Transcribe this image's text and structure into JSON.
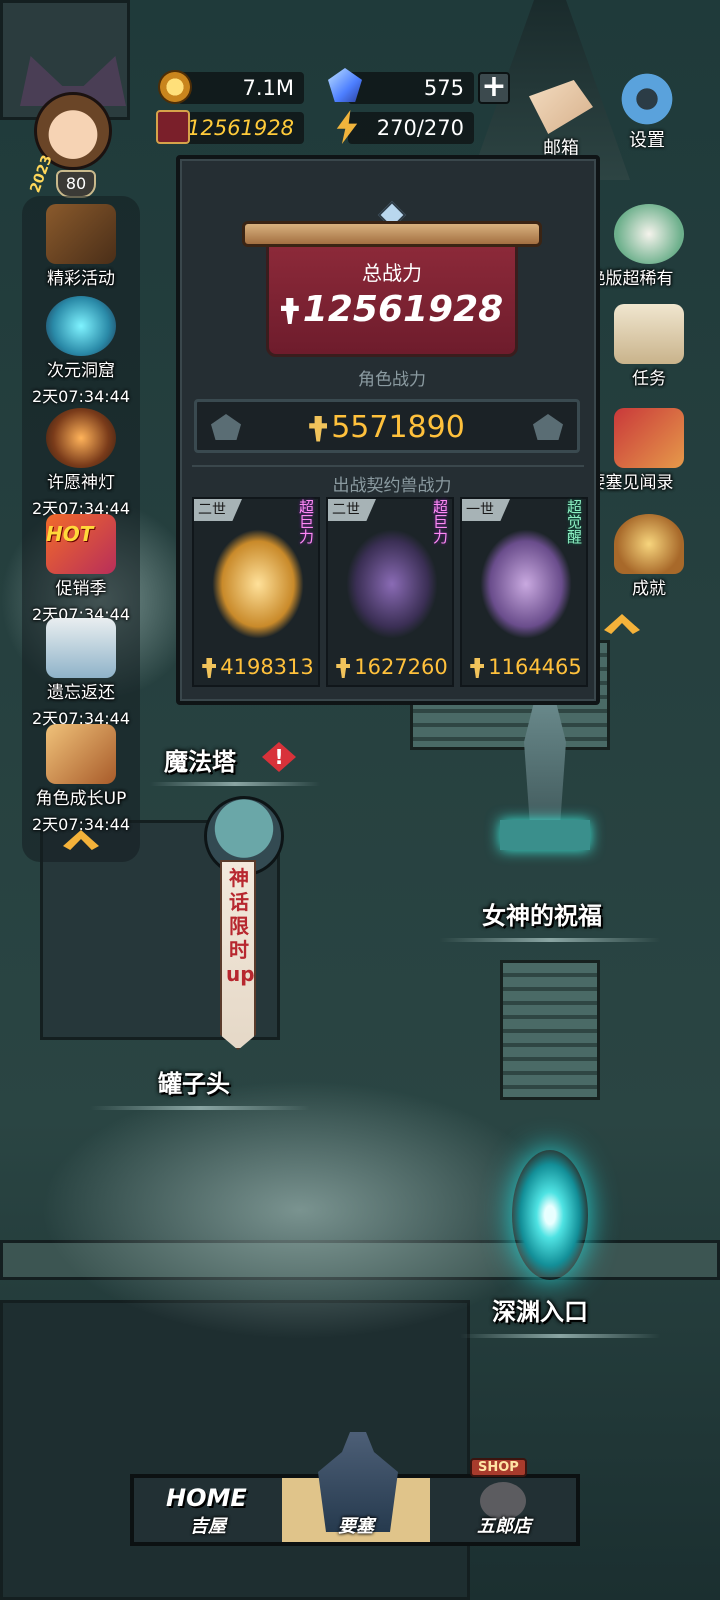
{
  "player": {
    "level": "80",
    "avatar_year": "2023"
  },
  "resources": {
    "coins": "7.1M",
    "gems": "575",
    "power": "12561928",
    "stamina": "270/270"
  },
  "top_buttons": {
    "mail": "邮箱",
    "settings": "设置"
  },
  "left_events": [
    {
      "label": "精彩活动",
      "timer": ""
    },
    {
      "label": "次元洞窟",
      "timer": "2天07:34:44"
    },
    {
      "label": "许愿神灯",
      "timer": "2天07:34:44"
    },
    {
      "label": "促销季",
      "timer": "2天07:34:44",
      "badge": "HOT"
    },
    {
      "label": "遗忘返还",
      "timer": "2天07:34:44"
    },
    {
      "label": "角色成长UP",
      "timer": "2天07:34:44"
    }
  ],
  "right_events": [
    {
      "label": "绝版超稀有"
    },
    {
      "label": "任务"
    },
    {
      "label": "要塞见闻录"
    },
    {
      "label": "成就"
    }
  ],
  "power_panel": {
    "title": "总战力",
    "total": "12561928",
    "char_title": "角色战力",
    "char_power": "5571890",
    "beast_title": "出战契约兽战力",
    "beasts": [
      {
        "tier": "二世",
        "tag": "超巨力",
        "power": "4198313"
      },
      {
        "tier": "二世",
        "tag": "超巨力",
        "power": "1627260"
      },
      {
        "tier": "一世",
        "tag": "超觉醒",
        "power": "1164465"
      }
    ]
  },
  "map": {
    "magic_tower": "魔法塔",
    "alert": "!",
    "myth_banner": "神话限时up",
    "goddess": "女神的祝福",
    "jar_head": "罐子头",
    "abyss": "深渊入口"
  },
  "nav": {
    "home_logo": "HOME",
    "home": "吉屋",
    "fortress": "要塞",
    "shop_logo": "SHOP",
    "shop": "五郎店"
  }
}
